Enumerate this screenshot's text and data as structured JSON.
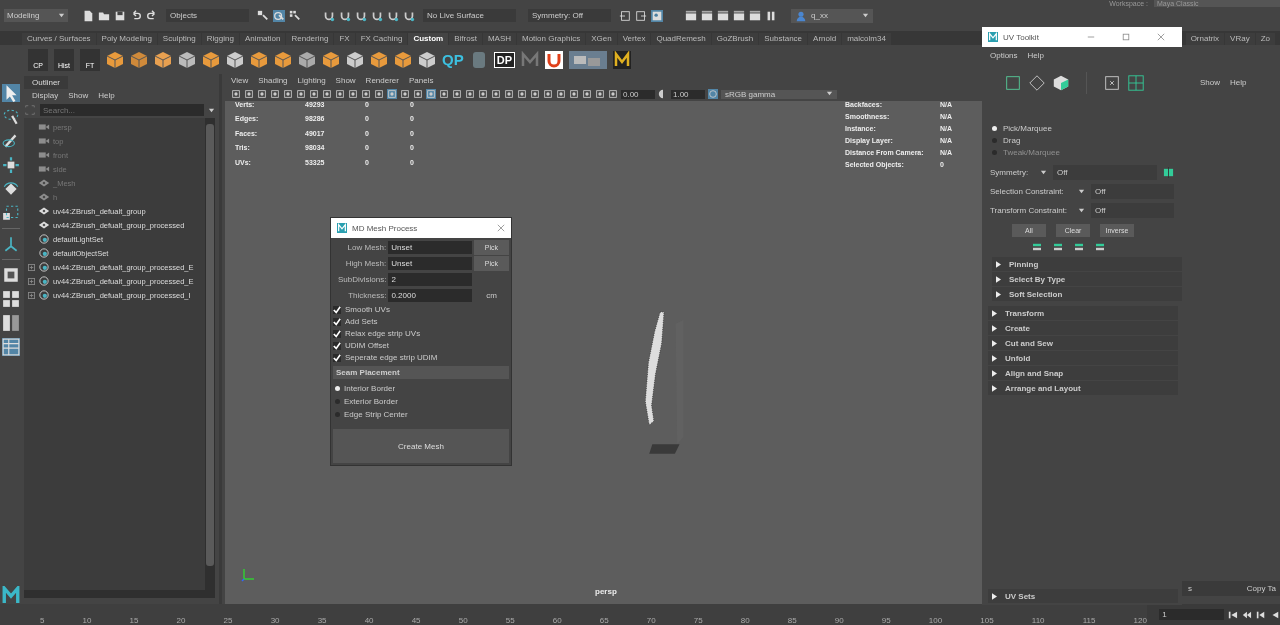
{
  "status_line": {
    "mode": "Modeling",
    "selection_mask": "Objects",
    "live_surface": "No Live Surface",
    "symmetry": "Symmetry: Off",
    "user_field": "q_xx",
    "workspace_label": "Workspace :",
    "workspace": "Maya Classic"
  },
  "shelf_tabs": [
    {
      "label": "Curves / Surfaces",
      "selected": false
    },
    {
      "label": "Poly Modeling",
      "selected": false
    },
    {
      "label": "Sculpting",
      "selected": false
    },
    {
      "label": "Rigging",
      "selected": false
    },
    {
      "label": "Animation",
      "selected": false
    },
    {
      "label": "Rendering",
      "selected": false
    },
    {
      "label": "FX",
      "selected": false
    },
    {
      "label": "FX Caching",
      "selected": false
    },
    {
      "label": "Custom",
      "selected": true
    },
    {
      "label": "Bifrost",
      "selected": false
    },
    {
      "label": "MASH",
      "selected": false
    },
    {
      "label": "Motion Graphics",
      "selected": false
    },
    {
      "label": "XGen",
      "selected": false
    },
    {
      "label": "Vertex",
      "selected": false
    },
    {
      "label": "QuadRemesh",
      "selected": false
    },
    {
      "label": "GoZBrush",
      "selected": false
    },
    {
      "label": "Substance",
      "selected": false
    },
    {
      "label": "Arnold",
      "selected": false
    },
    {
      "label": "malcolm34",
      "selected": false
    }
  ],
  "shelf_tabs_right": [
    {
      "label": "Ornatrix",
      "selected": false
    },
    {
      "label": "VRay",
      "selected": false
    },
    {
      "label": "Zo",
      "selected": false
    }
  ],
  "shelf_labels": [
    "CP",
    "Hist",
    "FT",
    "QP",
    "DP"
  ],
  "outliner": {
    "title": "Outliner",
    "menu": [
      "Display",
      "Show",
      "Help"
    ],
    "search_placeholder": "Search...",
    "items": [
      {
        "name": "persp",
        "kind": "camera",
        "dimmed": true,
        "expandable": false
      },
      {
        "name": "top",
        "kind": "camera",
        "dimmed": true,
        "expandable": false
      },
      {
        "name": "front",
        "kind": "camera",
        "dimmed": true,
        "expandable": false
      },
      {
        "name": "side",
        "kind": "camera",
        "dimmed": true,
        "expandable": false
      },
      {
        "name": "_Mesh",
        "kind": "transform",
        "dimmed": true,
        "expandable": false
      },
      {
        "name": "h",
        "kind": "transform",
        "dimmed": true,
        "expandable": false
      },
      {
        "name": "uv44:ZBrush_defualt_group",
        "kind": "transform",
        "dimmed": false,
        "expandable": false
      },
      {
        "name": "uv44:ZBrush_defualt_group_processed",
        "kind": "transform",
        "dimmed": false,
        "expandable": false
      },
      {
        "name": "defaultLightSet",
        "kind": "set",
        "dimmed": false,
        "expandable": false
      },
      {
        "name": "defaultObjectSet",
        "kind": "set",
        "dimmed": false,
        "expandable": false
      },
      {
        "name": "uv44:ZBrush_defualt_group_processed_E",
        "kind": "set",
        "dimmed": false,
        "expandable": true
      },
      {
        "name": "uv44:ZBrush_defualt_group_processed_E",
        "kind": "set",
        "dimmed": false,
        "expandable": true
      },
      {
        "name": "uv44:ZBrush_defualt_group_processed_I",
        "kind": "set",
        "dimmed": false,
        "expandable": true
      }
    ]
  },
  "viewport": {
    "menu": [
      "View",
      "Shading",
      "Lighting",
      "Show",
      "Renderer",
      "Panels"
    ],
    "exposure": "0.00",
    "gamma": "1.00",
    "color_space": "sRGB gamma",
    "camera": "persp",
    "hud_left": [
      {
        "label": "Verts:",
        "values": [
          "49293",
          "0",
          "0"
        ]
      },
      {
        "label": "Edges:",
        "values": [
          "98286",
          "0",
          "0"
        ]
      },
      {
        "label": "Faces:",
        "values": [
          "49017",
          "0",
          "0"
        ]
      },
      {
        "label": "Tris:",
        "values": [
          "98034",
          "0",
          "0"
        ]
      },
      {
        "label": "UVs:",
        "values": [
          "53325",
          "0",
          "0"
        ]
      }
    ],
    "hud_right": [
      {
        "label": "Backfaces:",
        "value": "N/A"
      },
      {
        "label": "Smoothness:",
        "value": "N/A"
      },
      {
        "label": "Instance:",
        "value": "N/A"
      },
      {
        "label": "Display Layer:",
        "value": "N/A"
      },
      {
        "label": "Distance From Camera:",
        "value": "N/A"
      },
      {
        "label": "Selected Objects:",
        "value": "0"
      }
    ]
  },
  "mesh_dialog": {
    "title": "MD Mesh Process",
    "fields": [
      {
        "label": "Low Mesh:",
        "value": "Unset",
        "button": "Pick"
      },
      {
        "label": "High Mesh:",
        "value": "Unset",
        "button": "Pick"
      },
      {
        "label": "SubDivisions:",
        "value": "2"
      },
      {
        "label": "Thickness:",
        "value": "0.2000",
        "unit": "cm"
      }
    ],
    "checkboxes": [
      {
        "label": "Smooth UVs",
        "checked": true
      },
      {
        "label": "Add Sets",
        "checked": true
      },
      {
        "label": "Relax edge strip UVs",
        "checked": true
      },
      {
        "label": "UDIM Offset",
        "checked": true
      },
      {
        "label": "Seperate edge strip UDIM",
        "checked": true
      }
    ],
    "section": "Seam Placement",
    "radios": [
      {
        "label": "Interior Border",
        "selected": true
      },
      {
        "label": "Exterior Border",
        "selected": false
      },
      {
        "label": "Edge Strip Center",
        "selected": false
      }
    ],
    "button": "Create Mesh"
  },
  "right_dock": {
    "menu": [
      "Show",
      "Help"
    ],
    "bottom_left": "s",
    "bottom_right": "Copy Ta"
  },
  "uv_toolkit": {
    "title": "UV Toolkit",
    "menu": [
      "Options",
      "Help"
    ],
    "radios": [
      {
        "label": "Pick/Marquee",
        "selected": true,
        "disabled": false
      },
      {
        "label": "Drag",
        "selected": false,
        "disabled": false
      },
      {
        "label": "Tweak/Marquee",
        "selected": false,
        "disabled": true
      }
    ],
    "dropdowns": [
      {
        "label": "Symmetry:",
        "value": "Off"
      },
      {
        "label": "Selection Constraint:",
        "value": "Off"
      },
      {
        "label": "Transform Constraint:",
        "value": "Off"
      }
    ],
    "buttons": [
      "All",
      "Clear",
      "Inverse"
    ],
    "sub_sections": [
      {
        "label": "Pinning",
        "expanded": false
      },
      {
        "label": "Select By Type",
        "expanded": false
      },
      {
        "label": "Soft Selection",
        "expanded": false
      }
    ],
    "sections": [
      {
        "label": "Transform",
        "expanded": false
      },
      {
        "label": "Create",
        "expanded": false
      },
      {
        "label": "Cut and Sew",
        "expanded": false
      },
      {
        "label": "Unfold",
        "expanded": false
      },
      {
        "label": "Align and Snap",
        "expanded": false
      },
      {
        "label": "Arrange and Layout",
        "expanded": false
      }
    ],
    "bottom_section": {
      "label": "UV Sets",
      "expanded": false
    }
  },
  "time_slider": {
    "ticks": [
      "5",
      "10",
      "15",
      "20",
      "25",
      "30",
      "35",
      "40",
      "45",
      "50",
      "55",
      "60",
      "65",
      "70",
      "75",
      "80",
      "85",
      "90",
      "95",
      "100",
      "105",
      "110",
      "115",
      "120"
    ],
    "current_frame": "1"
  }
}
